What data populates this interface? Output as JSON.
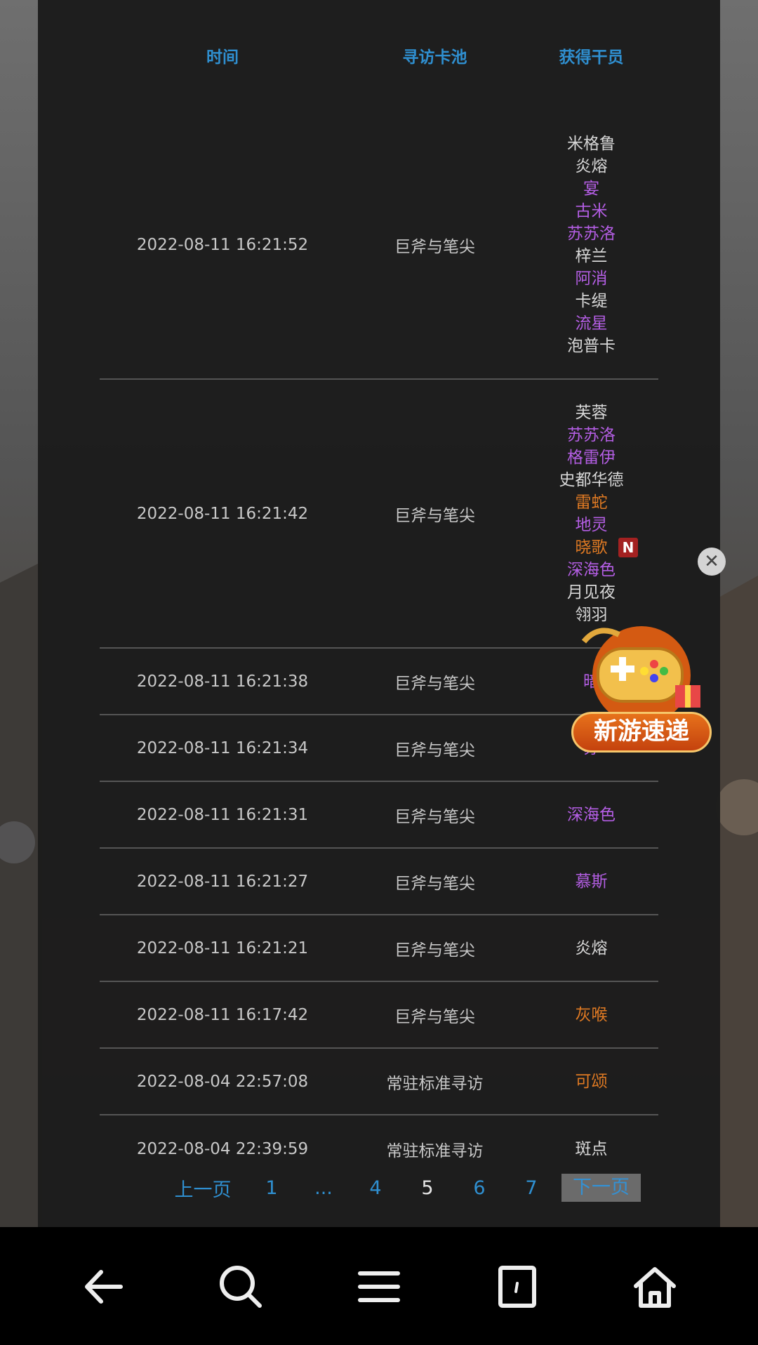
{
  "table": {
    "headers": {
      "time": "时间",
      "pool": "寻访卡池",
      "operators": "获得干员"
    },
    "rows": [
      {
        "time": "2022-08-11 16:21:52",
        "pool": "巨斧与笔尖",
        "ops": [
          {
            "name": "米格鲁",
            "rarity": "white"
          },
          {
            "name": "炎熔",
            "rarity": "white"
          },
          {
            "name": "宴",
            "rarity": "purple"
          },
          {
            "name": "古米",
            "rarity": "purple"
          },
          {
            "name": "苏苏洛",
            "rarity": "purple"
          },
          {
            "name": "梓兰",
            "rarity": "white"
          },
          {
            "name": "阿消",
            "rarity": "purple"
          },
          {
            "name": "卡缇",
            "rarity": "white"
          },
          {
            "name": "流星",
            "rarity": "purple"
          },
          {
            "name": "泡普卡",
            "rarity": "white"
          }
        ]
      },
      {
        "time": "2022-08-11 16:21:42",
        "pool": "巨斧与笔尖",
        "ops": [
          {
            "name": "芙蓉",
            "rarity": "white"
          },
          {
            "name": "苏苏洛",
            "rarity": "purple"
          },
          {
            "name": "格雷伊",
            "rarity": "purple"
          },
          {
            "name": "史都华德",
            "rarity": "white"
          },
          {
            "name": "雷蛇",
            "rarity": "orange"
          },
          {
            "name": "地灵",
            "rarity": "purple"
          },
          {
            "name": "晓歌",
            "rarity": "orange",
            "badge": "N"
          },
          {
            "name": "深海色",
            "rarity": "purple"
          },
          {
            "name": "月见夜",
            "rarity": "white"
          },
          {
            "name": "翎羽",
            "rarity": "white"
          }
        ]
      },
      {
        "time": "2022-08-11 16:21:38",
        "pool": "巨斧与笔尖",
        "ops": [
          {
            "name": "暗",
            "rarity": "purple"
          }
        ]
      },
      {
        "time": "2022-08-11 16:21:34",
        "pool": "巨斧与笔尖",
        "ops": [
          {
            "name": "苏",
            "rarity": "purple"
          }
        ]
      },
      {
        "time": "2022-08-11 16:21:31",
        "pool": "巨斧与笔尖",
        "ops": [
          {
            "name": "深海色",
            "rarity": "purple"
          }
        ]
      },
      {
        "time": "2022-08-11 16:21:27",
        "pool": "巨斧与笔尖",
        "ops": [
          {
            "name": "慕斯",
            "rarity": "purple"
          }
        ]
      },
      {
        "time": "2022-08-11 16:21:21",
        "pool": "巨斧与笔尖",
        "ops": [
          {
            "name": "炎熔",
            "rarity": "white"
          }
        ]
      },
      {
        "time": "2022-08-11 16:17:42",
        "pool": "巨斧与笔尖",
        "ops": [
          {
            "name": "灰喉",
            "rarity": "orange"
          }
        ]
      },
      {
        "time": "2022-08-04 22:57:08",
        "pool": "常驻标准寻访",
        "ops": [
          {
            "name": "可颂",
            "rarity": "orange"
          }
        ]
      },
      {
        "time": "2022-08-04 22:39:59",
        "pool": "常驻标准寻访",
        "ops": [
          {
            "name": "斑点",
            "rarity": "white"
          }
        ]
      }
    ]
  },
  "pagination": {
    "prev": "上一页",
    "pages": [
      "1",
      "...",
      "4",
      "5",
      "6",
      "7"
    ],
    "current": "5",
    "next": "下一页"
  },
  "ad": {
    "label": "新游速递",
    "close": "✕"
  },
  "navbar": {
    "icons": [
      "back-icon",
      "search-icon",
      "menu-icon",
      "tabs-icon",
      "home-icon"
    ]
  },
  "colors": {
    "header": "#2f8fd0",
    "rarity_white": "#d7d7d7",
    "rarity_purple": "#b45ee4",
    "rarity_orange": "#e07a23"
  }
}
